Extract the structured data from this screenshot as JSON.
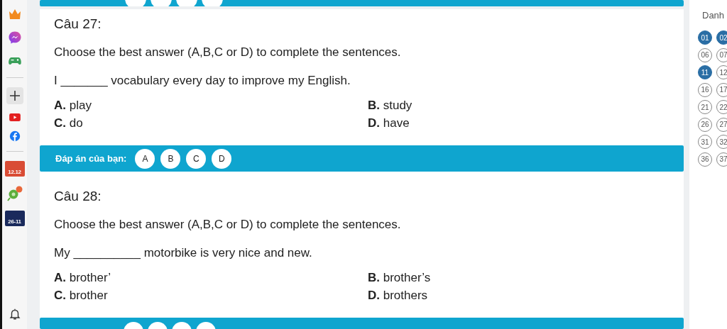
{
  "sidebar": {
    "items": [
      {
        "kind": "crown"
      },
      {
        "kind": "messenger"
      },
      {
        "kind": "gamepad"
      },
      {
        "kind": "divider"
      },
      {
        "kind": "plus"
      },
      {
        "kind": "youtube"
      },
      {
        "kind": "facebook"
      },
      {
        "kind": "divider"
      },
      {
        "kind": "calendar",
        "label": "12.12"
      },
      {
        "kind": "pin"
      },
      {
        "kind": "promo",
        "label": "26-11"
      }
    ]
  },
  "questions": [
    {
      "title": "Câu 27:",
      "instruction": "Choose the best answer (A,B,C or D) to complete the sentences.",
      "sentence": "I _______ vocabulary every day to improve my English.",
      "options": [
        "**A.** play",
        "**B.** study",
        "**C.** do",
        "**D.** have"
      ],
      "answer": {
        "label": "Đáp án của bạn:",
        "choices": [
          {
            "label": "A",
            "selected": false
          },
          {
            "label": "B",
            "selected": false
          },
          {
            "label": "C",
            "selected": false
          },
          {
            "label": "D",
            "selected": false
          }
        ]
      }
    },
    {
      "title": "Câu 28:",
      "instruction": "Choose the best answer (A,B,C or D) to complete the sentences.",
      "sentence": "My __________ motorbike is very nice and new.",
      "options": [
        "**A.** brother’",
        "**B.** brother’s",
        "**C.** brother",
        "**D.** brothers"
      ]
    }
  ],
  "panel": {
    "title": "Danh",
    "numbers": [
      {
        "label": "01",
        "selected": true
      },
      {
        "label": "02",
        "selected": true
      },
      {
        "label": "06",
        "selected": false
      },
      {
        "label": "07",
        "selected": false
      },
      {
        "label": "11",
        "selected": true
      },
      {
        "label": "12",
        "selected": false
      },
      {
        "label": "16",
        "selected": false
      },
      {
        "label": "17",
        "selected": false
      },
      {
        "label": "21",
        "selected": false
      },
      {
        "label": "22",
        "selected": false
      },
      {
        "label": "26",
        "selected": false
      },
      {
        "label": "27",
        "selected": false
      },
      {
        "label": "31",
        "selected": false
      },
      {
        "label": "32",
        "selected": false
      },
      {
        "label": "36",
        "selected": false
      },
      {
        "label": "37",
        "selected": false
      }
    ]
  }
}
